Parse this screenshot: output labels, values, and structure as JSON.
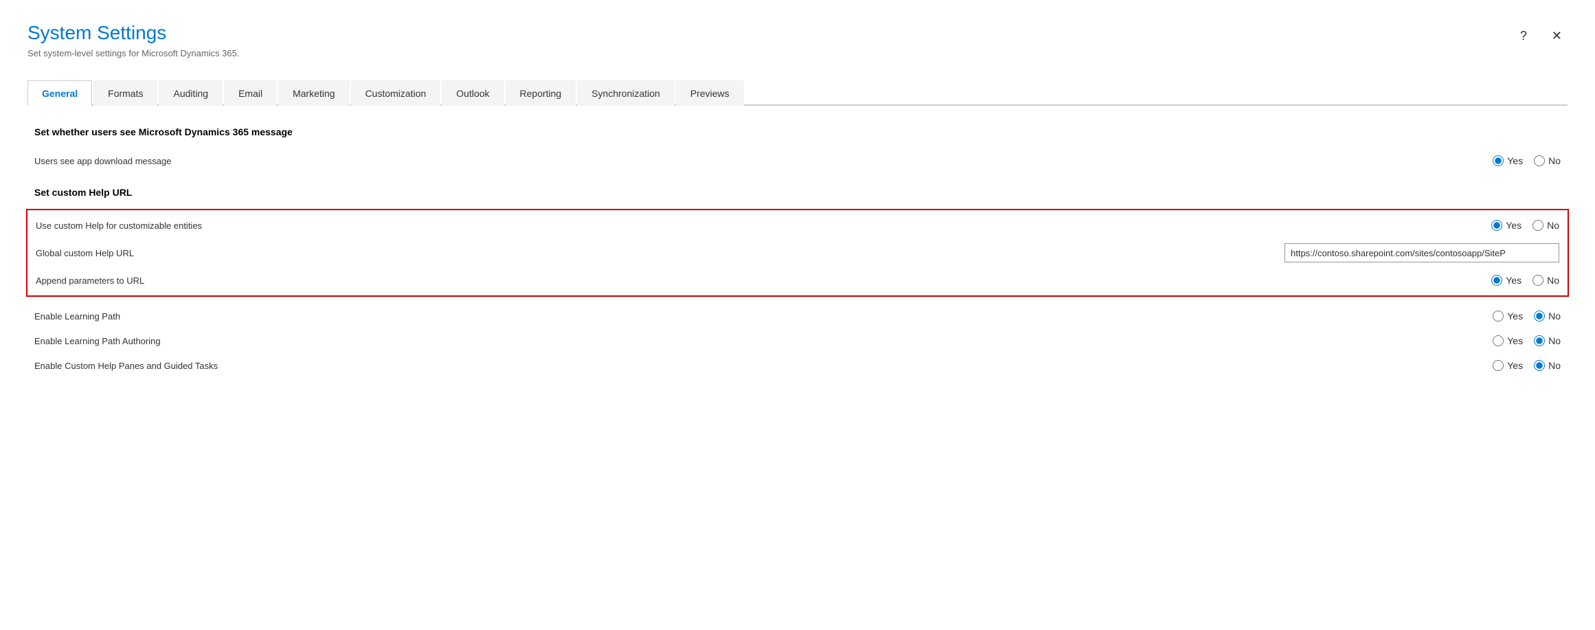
{
  "dialog": {
    "title": "System Settings",
    "subtitle": "Set system-level settings for Microsoft Dynamics 365.",
    "help_label": "?",
    "close_label": "✕"
  },
  "tabs": [
    {
      "id": "general",
      "label": "General",
      "active": true
    },
    {
      "id": "formats",
      "label": "Formats",
      "active": false
    },
    {
      "id": "auditing",
      "label": "Auditing",
      "active": false
    },
    {
      "id": "email",
      "label": "Email",
      "active": false
    },
    {
      "id": "marketing",
      "label": "Marketing",
      "active": false
    },
    {
      "id": "customization",
      "label": "Customization",
      "active": false
    },
    {
      "id": "outlook",
      "label": "Outlook",
      "active": false
    },
    {
      "id": "reporting",
      "label": "Reporting",
      "active": false
    },
    {
      "id": "synchronization",
      "label": "Synchronization",
      "active": false
    },
    {
      "id": "previews",
      "label": "Previews",
      "active": false
    }
  ],
  "sections": {
    "dynamics_message": {
      "heading": "Set whether users see Microsoft Dynamics 365 message",
      "settings": [
        {
          "id": "app_download_message",
          "label": "Users see app download message",
          "type": "radio",
          "value": "yes",
          "options": [
            "Yes",
            "No"
          ]
        }
      ]
    },
    "custom_help": {
      "heading": "Set custom Help URL",
      "highlighted": true,
      "settings": [
        {
          "id": "custom_help_entities",
          "label": "Use custom Help for customizable entities",
          "type": "radio",
          "value": "yes",
          "options": [
            "Yes",
            "No"
          ]
        },
        {
          "id": "global_custom_help_url",
          "label": "Global custom Help URL",
          "type": "text",
          "value": "https://contoso.sharepoint.com/sites/contosoapp/SiteP"
        },
        {
          "id": "append_parameters",
          "label": "Append parameters to URL",
          "type": "radio",
          "value": "yes",
          "options": [
            "Yes",
            "No"
          ]
        }
      ]
    },
    "learning": {
      "settings": [
        {
          "id": "enable_learning_path",
          "label": "Enable Learning Path",
          "type": "radio",
          "value": "no",
          "options": [
            "Yes",
            "No"
          ]
        },
        {
          "id": "enable_learning_path_authoring",
          "label": "Enable Learning Path Authoring",
          "type": "radio",
          "value": "no",
          "options": [
            "Yes",
            "No"
          ]
        },
        {
          "id": "enable_custom_help_panes",
          "label": "Enable Custom Help Panes and Guided Tasks",
          "type": "radio",
          "value": "no",
          "options": [
            "Yes",
            "No"
          ]
        }
      ]
    }
  }
}
